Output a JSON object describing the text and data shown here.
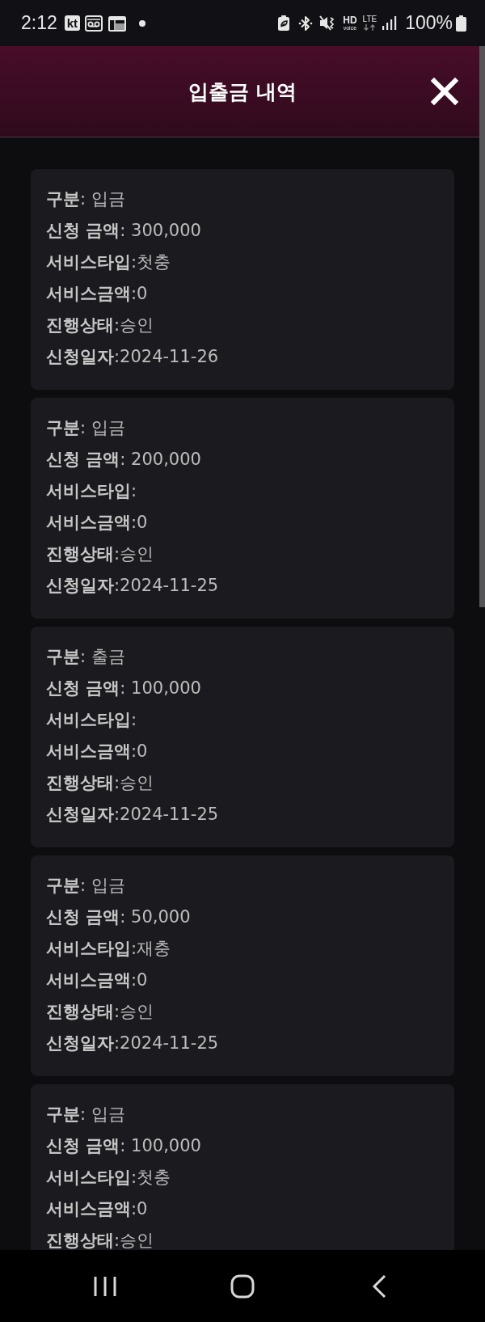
{
  "status_bar": {
    "time": "2:12",
    "carrier_logo": "kt",
    "hd_voice": {
      "label": "HD",
      "sublabel": "voice"
    },
    "network": "LTE",
    "battery": "100%"
  },
  "header": {
    "title": "입출금 내역"
  },
  "records": [
    {
      "lines": [
        "**구분**: 입금",
        "**신청 금액**: 300,000",
        "**서비스타입**:첫충",
        "**서비스금액**:0",
        "**진행상태**:승인",
        "**신청일자**:2024-11-26"
      ]
    },
    {
      "lines": [
        "**구분**: 입금",
        "**신청 금액**: 200,000",
        "**서비스타입**:",
        "**서비스금액**:0",
        "**진행상태**:승인",
        "**신청일자**:2024-11-25"
      ]
    },
    {
      "lines": [
        "**구분**: 출금",
        "**신청 금액**: 100,000",
        "**서비스타입**:",
        "**서비스금액**:0",
        "**진행상태**:승인",
        "**신청일자**:2024-11-25"
      ]
    },
    {
      "lines": [
        "**구분**: 입금",
        "**신청 금액**: 50,000",
        "**서비스타입**:재충",
        "**서비스금액**:0",
        "**진행상태**:승인",
        "**신청일자**:2024-11-25"
      ]
    },
    {
      "lines": [
        "**구분**: 입금",
        "**신청 금액**: 100,000",
        "**서비스타입**:첫충",
        "**서비스금액**:0",
        "**진행상태**:승인"
      ]
    }
  ]
}
